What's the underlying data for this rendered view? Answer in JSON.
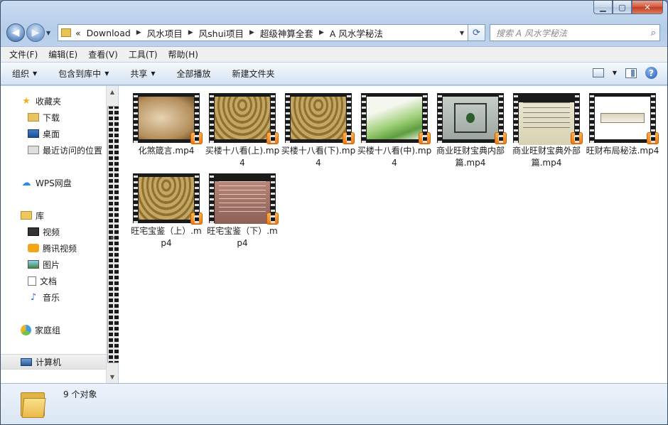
{
  "address": {
    "prefix": "«",
    "crumbs": [
      "Download",
      "风水项目",
      "风shui项目",
      "超级神算全套",
      "A 风水学秘法"
    ]
  },
  "search": {
    "placeholder": "搜索 A 风水学秘法"
  },
  "menu": [
    "文件(F)",
    "编辑(E)",
    "查看(V)",
    "工具(T)",
    "帮助(H)"
  ],
  "toolbar": {
    "organize": "组织",
    "include_library": "包含到库中",
    "share": "共享",
    "play_all": "全部播放",
    "new_folder": "新建文件夹"
  },
  "nav": {
    "favorites": "收藏夹",
    "downloads": "下载",
    "desktop": "桌面",
    "recent": "最近访问的位置",
    "wps": "WPS网盘",
    "libraries": "库",
    "videos": "视频",
    "tencent": "腾讯视频",
    "pictures": "图片",
    "documents": "文档",
    "music": "音乐",
    "homegroup": "家庭组",
    "computer": "计算机"
  },
  "files": [
    {
      "name": "化煞箴言.mp4",
      "thumb": "scroll"
    },
    {
      "name": "买楼十八看(上).mp4",
      "thumb": "gold"
    },
    {
      "name": "买楼十八看(下).mp4",
      "thumb": "gold"
    },
    {
      "name": "买楼十八看(中).mp4",
      "thumb": "leaf"
    },
    {
      "name": "商业旺财宝典内部篇.mp4",
      "thumb": "grid"
    },
    {
      "name": "商业旺财宝典外部篇.mp4",
      "thumb": "text"
    },
    {
      "name": "旺财布局秘法.mp4",
      "thumb": "banner"
    },
    {
      "name": "旺宅宝鉴（上）.mp4",
      "thumb": "gold"
    },
    {
      "name": "旺宅宝鉴（下）.mp4",
      "thumb": "red"
    }
  ],
  "status": {
    "count": "9 个对象"
  }
}
